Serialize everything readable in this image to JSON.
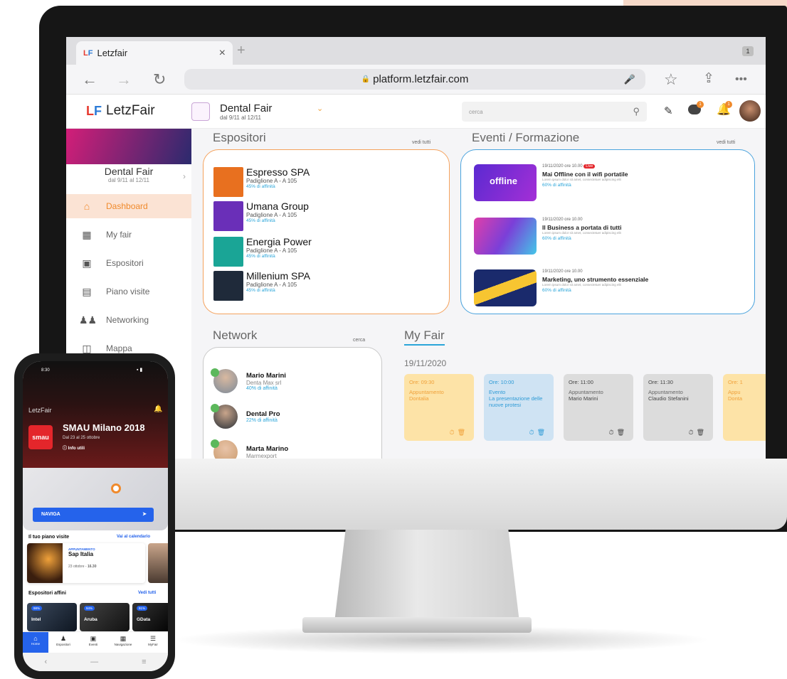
{
  "browser": {
    "tab_title": "Letzfair",
    "tab_close": "×",
    "tab_new": "+",
    "tab_count": "1",
    "url": "platform.letzfair.com"
  },
  "app": {
    "brand": "LetzFair",
    "fair_title": "Dental Fair",
    "fair_dates": "dal 9/11 al 12/11",
    "search_placeholder": "cerca",
    "notif_chat_count": "1",
    "notif_bell_count": "1"
  },
  "sidebar": {
    "fair_title": "Dental Fair",
    "fair_dates": "dal 9/11 al 12/11",
    "items": [
      {
        "label": "Dashboard",
        "icon": "home-icon",
        "active": true
      },
      {
        "label": "My fair",
        "icon": "id-card-icon"
      },
      {
        "label": "Espositori",
        "icon": "storefront-icon"
      },
      {
        "label": "Piano visite",
        "icon": "calendar-icon"
      },
      {
        "label": "Networking",
        "icon": "people-icon"
      },
      {
        "label": "Mappa",
        "icon": "map-icon"
      }
    ]
  },
  "espositori": {
    "title": "Espositori",
    "link": "vedi tutti",
    "items": [
      {
        "name": "Espresso SPA",
        "location": "Padiglione A - A 105",
        "affinity": "45% di affinità",
        "logo_color": "#e8701f"
      },
      {
        "name": "Umana Group",
        "location": "Padiglione A - A 105",
        "affinity": "45% di affinità",
        "logo_color": "#6a2fb8"
      },
      {
        "name": "Energia Power",
        "location": "Padiglione A - A 105",
        "affinity": "45% di affinità",
        "logo_color": "#1aa596"
      },
      {
        "name": "Millenium SPA",
        "location": "Padiglione A - A 105",
        "affinity": "45% di affinità",
        "logo_color": "#1f2a3a"
      }
    ]
  },
  "eventi": {
    "title": "Eventi / Formazione",
    "link": "vedi tutti",
    "live_badge": "Live",
    "items": [
      {
        "date": "19/11/2020 ore 10.00",
        "title": "Mai Offline con il wifi portatile",
        "lorem": "Lorem ipsum dolor sit amet, consectetuer adipiscing elit",
        "affinity": "60% di affinità",
        "img_label": "offline"
      },
      {
        "date": "19/11/2020 ore 10.00",
        "title": "Il Business a portata di tutti",
        "lorem": "Lorem ipsum dolor sit amet, consectetuer adipiscing elit",
        "affinity": "60% di affinità"
      },
      {
        "date": "19/11/2020 ore 10.00",
        "title": "Marketing, uno strumento essenziale",
        "lorem": "Lorem ipsum dolor sit amet, consectetuer adipiscing elit",
        "affinity": "60% di affinità"
      }
    ]
  },
  "network": {
    "title": "Network",
    "link": "cerca",
    "items": [
      {
        "name": "Mario Marini",
        "company": "Denta Max srl",
        "affinity": "40% di affinità"
      },
      {
        "name": "Dental Pro",
        "company": "",
        "affinity": "22% di affinità"
      },
      {
        "name": "Marta Marino",
        "company": "Marmexport",
        "affinity": ""
      }
    ]
  },
  "myfair": {
    "title": "My Fair",
    "date": "19/11/2020",
    "appointments": [
      {
        "time": "Ore: 09:30",
        "type": "Appuntamento",
        "who": "Dontalia",
        "color": "#fde3a7",
        "text_color": "#f0a13a"
      },
      {
        "time": "Ore: 10:00",
        "type": "Evento",
        "who": "La presentazione delle nuove protesi",
        "color": "#cfe3f3",
        "text_color": "#2f9bd6"
      },
      {
        "time": "Ore: 11:00",
        "type": "Appuntamento",
        "who": "Mario Marini",
        "color": "#d9d9d9",
        "text_color": "#444"
      },
      {
        "time": "Ore: 11:30",
        "type": "Appuntamento",
        "who": "Claudio Stefanini",
        "color": "#d9d9d9",
        "text_color": "#444"
      },
      {
        "time": "Ore: 1",
        "type": "Appu",
        "who": "Donta",
        "color": "#fde3a7",
        "text_color": "#f0a13a"
      }
    ]
  },
  "phone": {
    "time": "8:30",
    "brand": "LetzFair",
    "event_title": "SMAU Milano 2018",
    "event_dates": "Dal 23 al 25 ottobre",
    "info_link": "Info utili",
    "logo_text": "smau",
    "naviga_button": "NAVIGA",
    "piano_title": "Il tuo piano visite",
    "piano_link": "Vai al calendario",
    "appt_label": "APPUNTAMENTO",
    "appt_name": "Sap Italia",
    "appt_date": "23 ottobre - ",
    "appt_time": "16.30",
    "espositori_title": "Espositori affini",
    "espositori_link": "Vedi tutti",
    "espositori": [
      {
        "name": "Intel",
        "percent": "98%"
      },
      {
        "name": "Aruba",
        "percent": "94%"
      },
      {
        "name": "GData",
        "percent": "91%"
      }
    ],
    "nav": [
      "Home",
      "Espositori",
      "Eventi",
      "Navigazione",
      "MyFair"
    ],
    "sys_nav": [
      "‹",
      "—",
      "≡"
    ]
  }
}
